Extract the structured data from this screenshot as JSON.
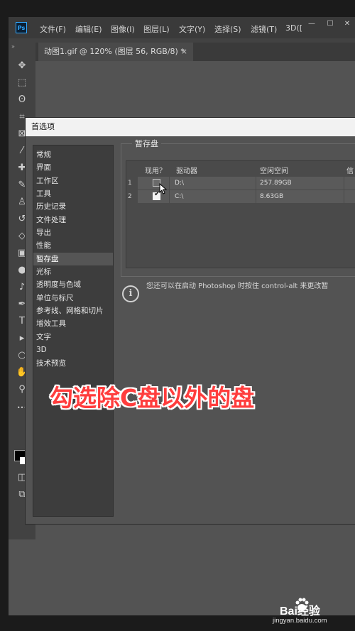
{
  "menubar": {
    "items": [
      "文件(F)",
      "编辑(E)",
      "图像(I)",
      "图层(L)",
      "文字(Y)",
      "选择(S)",
      "滤镜(T)",
      "3D(["
    ],
    "app_icon": "Ps",
    "window_buttons": [
      "—",
      "☐",
      "✕"
    ]
  },
  "document_tab": {
    "title": "动图1.gif @ 120% (图层 56, RGB/8) *",
    "close": "×"
  },
  "dialog": {
    "title": "首选项",
    "categories": [
      "常规",
      "界面",
      "工作区",
      "工具",
      "历史记录",
      "文件处理",
      "导出",
      "性能",
      "暂存盘",
      "光标",
      "透明度与色域",
      "单位与标尺",
      "参考线、网格和切片",
      "增效工具",
      "文字",
      "3D",
      "技术预览"
    ],
    "selected_category": "暂存盘",
    "scratch_disks": {
      "title": "暂存盘",
      "columns": [
        "现用？",
        "驱动器",
        "空闲空间",
        "信"
      ],
      "rows": [
        {
          "num": "1",
          "active": false,
          "drive": "D:\\",
          "free": "257.89GB"
        },
        {
          "num": "2",
          "active": true,
          "drive": "C:\\",
          "free": "8.63GB"
        }
      ]
    },
    "info_text": "您还可以在启动 Photoshop 时按住 control-alt 来更改暂"
  },
  "caption": "勾选除C盘以外的盘",
  "watermark": {
    "text": "Bai经验",
    "url": "jingyan.baidu.com"
  },
  "colors": {
    "caption": "#ff3d3d",
    "dialog_bg": "#535353",
    "menubar_bg": "#3a3a3a"
  },
  "icons": [
    "move-icon",
    "marquee-icon",
    "lasso-icon",
    "crop-icon",
    "frame-icon",
    "eyedropper-icon",
    "brush-icon",
    "stamp-icon",
    "history-brush-icon",
    "eraser-icon",
    "gradient-icon",
    "blur-icon",
    "dodge-icon",
    "pen-icon",
    "type-icon",
    "path-select-icon",
    "shape-icon",
    "hand-icon",
    "zoom-icon"
  ]
}
